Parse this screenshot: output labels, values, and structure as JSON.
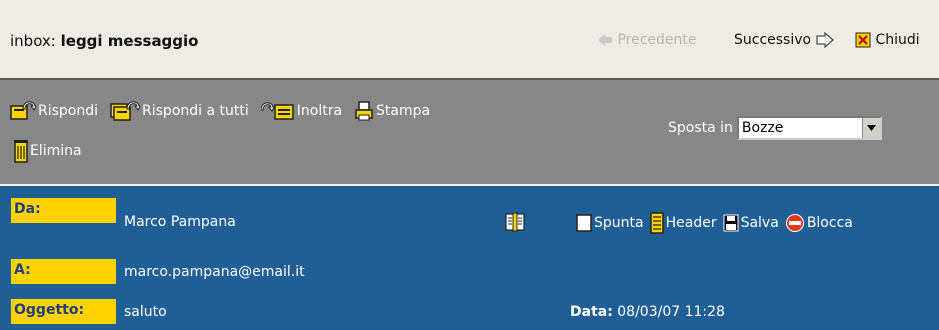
{
  "title": {
    "prefix": "inbox:",
    "main": "leggi messaggio"
  },
  "nav": {
    "prev": "Precedente",
    "next": "Successivo",
    "close": "Chiudi"
  },
  "toolbar": {
    "reply": "Rispondi",
    "reply_all": "Rispondi a tutti",
    "forward": "Inoltra",
    "print": "Stampa",
    "delete": "Elimina",
    "move_label": "Sposta in",
    "move_value": "Bozze"
  },
  "message": {
    "from_label": "Da:",
    "from_value": "Marco Pampana",
    "to_label": "A:",
    "to_value": "marco.pampana@email.it",
    "subject_label": "Oggetto:",
    "subject_value": "saluto",
    "date_label": "Data:",
    "date_value": "08/03/07 11:28"
  },
  "actions": {
    "mark": "Spunta",
    "header": "Header",
    "save": "Salva",
    "block": "Blocca"
  },
  "colors": {
    "toolbar_bg": "#878787",
    "header_bg": "#1f5f96",
    "label_bg": "#ffd200",
    "icon_yellow": "#f5d400",
    "block_red": "#e03b1c"
  },
  "icons": [
    "arrow-left-icon",
    "arrow-right-icon",
    "close-x-icon",
    "reply-icon",
    "reply-all-icon",
    "forward-icon",
    "print-icon",
    "trash-icon",
    "dropdown-arrow-icon",
    "address-book-icon",
    "checkbox-icon",
    "header-icon",
    "save-disk-icon",
    "block-icon"
  ]
}
